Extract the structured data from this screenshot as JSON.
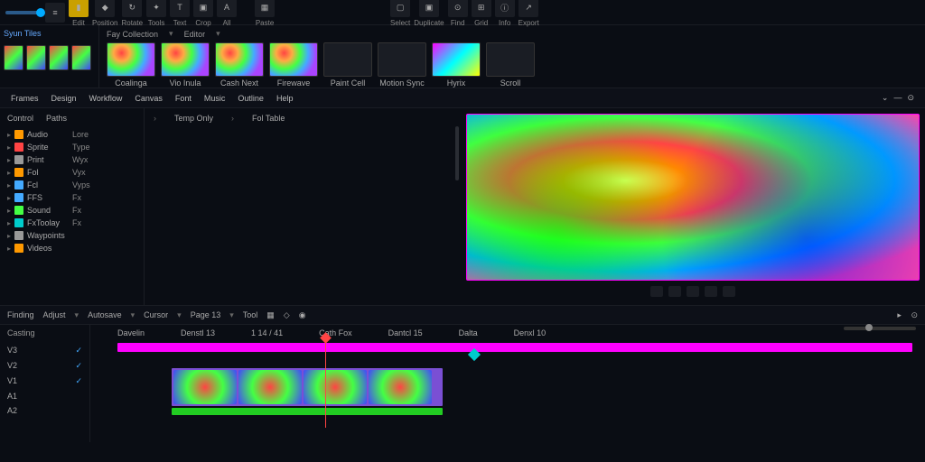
{
  "toolbar": {
    "items": [
      "Edit",
      "Position",
      "Rotate",
      "Tools",
      "Text",
      "Crop",
      "All",
      "Paste",
      "Select",
      "Duplicate",
      "Find",
      "Grid",
      "Info",
      "Export"
    ]
  },
  "row2": {
    "leftTitle": "Syun Tiles",
    "fxLabel": "Fay Collection",
    "fxSort": "Editor",
    "thumbs": [
      {
        "l": "Coalinga"
      },
      {
        "l": "Vio Inula"
      },
      {
        "l": "Cash Next"
      },
      {
        "l": "Firewave"
      },
      {
        "l": "Paint Cell"
      },
      {
        "l": "Motion Sync"
      },
      {
        "l": "Hyrix"
      },
      {
        "l": "Scroll"
      }
    ]
  },
  "menu": {
    "items": [
      "Frames",
      "Design",
      "Workflow",
      "Canvas",
      "Font",
      "Music",
      "Outline",
      "Help"
    ]
  },
  "panelL": {
    "hdr": [
      "Control",
      "Paths"
    ],
    "tree": [
      {
        "n": "Audio",
        "c": "or"
      },
      {
        "n": "Sprite",
        "c": "rd"
      },
      {
        "n": "Print",
        "c": "gr"
      },
      {
        "n": "Fol",
        "c": "or"
      },
      {
        "n": "Fcl",
        "c": "bl"
      },
      {
        "n": "FFS",
        "c": "bl"
      },
      {
        "n": "Sound",
        "c": "gn"
      },
      {
        "n": "FxToolay",
        "c": "cy"
      },
      {
        "n": "Waypoints",
        "c": "gr"
      },
      {
        "n": "Videos",
        "c": "or"
      }
    ],
    "sub": [
      "Lore",
      "Type",
      "Wyx",
      "Vyx",
      "Vyps",
      "Fx",
      "Fx",
      "Fx"
    ]
  },
  "panelM": {
    "tabs": [
      "Temp Only",
      "Fol Table"
    ]
  },
  "tlTools": {
    "l": [
      "Finding",
      "Adjust",
      "Autosave",
      "Cursor",
      "Page 13",
      "Tool"
    ],
    "play": "▸"
  },
  "tlLeft": {
    "lbl": "Casting",
    "tracks": [
      "V3",
      "V2",
      "V1",
      "A1",
      "A2"
    ]
  },
  "ruler": [
    "Davelin",
    "Denstl 13",
    "1 14 / 41",
    "Cath Fox",
    "Dantcl 15",
    "Dalta",
    "Denxl 10"
  ]
}
